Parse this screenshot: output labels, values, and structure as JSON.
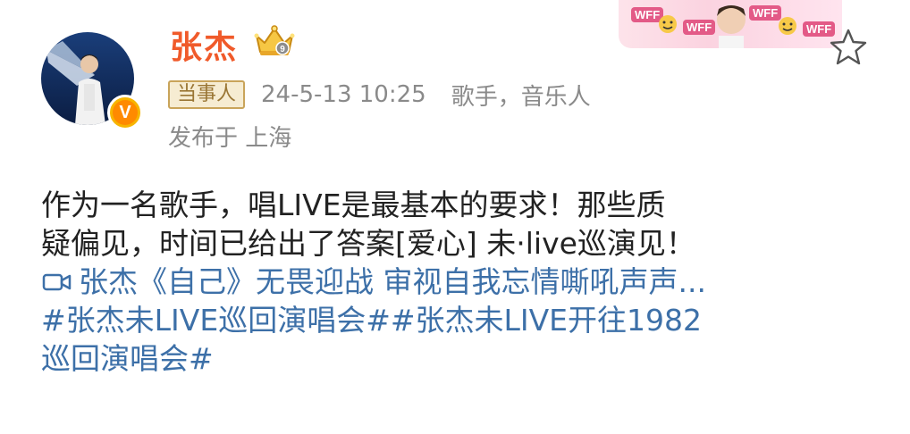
{
  "user": {
    "name": "张杰",
    "verified_badge": "V",
    "member_crown_level": "9"
  },
  "banner": {
    "badge_text": "WFF"
  },
  "meta": {
    "role_tag": "当事人",
    "timestamp": "24-5-13 10:25",
    "source": "歌手，音乐人",
    "location": "发布于 上海"
  },
  "post": {
    "line1": "作为一名歌手，唱LIVE是最基本的要求！那些质",
    "line2": "疑偏见，时间已给出了答案[爱心] 未·live巡演见！",
    "video_title": "张杰《自己》无畏迎战 审视自我忘情嘶吼声声...",
    "hashtag_line1": "#张杰未LIVE巡回演唱会##张杰未LIVE开往1982",
    "hashtag_line2": "巡回演唱会#"
  },
  "icons": {
    "favorite": "star-outline-icon",
    "video": "video-camera-icon",
    "crown": "crown-icon"
  },
  "colors": {
    "username": "#f05a2a",
    "link": "#3d70a8",
    "meta_gray": "#8a8a8a",
    "tag_gold": "#c9a45a",
    "badge_orange": "#ff8a00"
  }
}
